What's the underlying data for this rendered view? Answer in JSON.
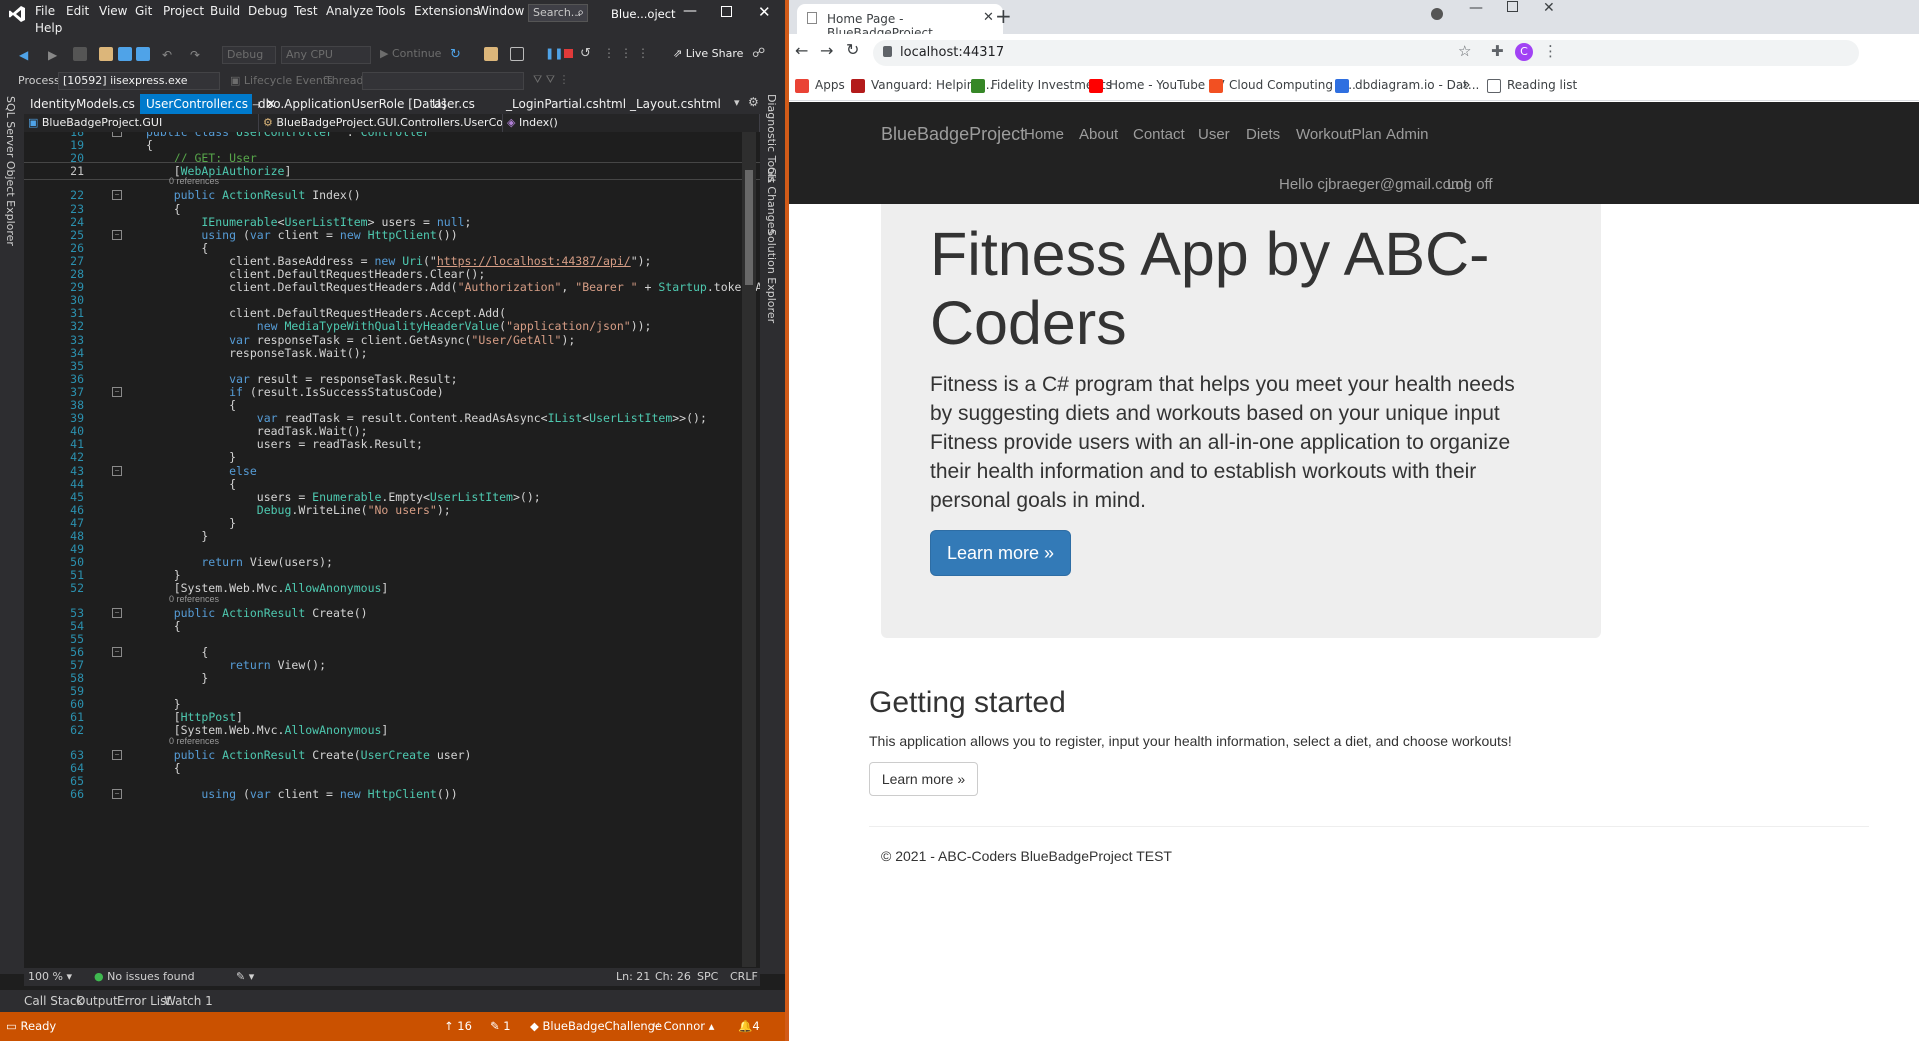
{
  "vs": {
    "menu": [
      "File",
      "Edit",
      "View",
      "Git",
      "Project",
      "Build",
      "Debug",
      "Test",
      "Analyze",
      "Tools",
      "Extensions",
      "Window",
      "Help"
    ],
    "search_placeholder": "Search...",
    "solution_title": "Blue...oject",
    "toolbar": {
      "config": "Debug",
      "platform": "Any CPU",
      "continue": "Continue",
      "live_share": "Live Share"
    },
    "toolbar2": {
      "process_label": "Process:",
      "process_value": "[10592] iisexpress.exe",
      "lifecycle": "Lifecycle Events",
      "thread_label": "Thread:"
    },
    "left_strip": "SQL Server Object Explorer",
    "right_strip": [
      "Diagnostic Tools",
      "Git Changes",
      "Solution Explorer"
    ],
    "tabs": [
      "IdentityModels.cs",
      "UserController.cs",
      "dbo.ApplicationUserRole [Data]",
      "User.cs",
      "_LoginPartial.cshtml",
      "_Layout.cshtml"
    ],
    "nav": {
      "project": "BlueBadgeProject.GUI",
      "class": "BlueBadgeProject.GUI.Controllers.UserController",
      "method": "Index()"
    },
    "code_lines": [
      {
        "n": "18",
        "segs": [
          [
            "kw",
            "public class "
          ],
          [
            "ty",
            "UserController"
          ],
          [
            "",
            "  : "
          ],
          [
            "ty",
            "Controller"
          ]
        ]
      },
      {
        "n": "19",
        "segs": [
          [
            "",
            "{"
          ]
        ]
      },
      {
        "n": "20",
        "segs": [
          [
            "cm",
            "    // GET: User"
          ]
        ]
      },
      {
        "n": "21",
        "segs": [
          [
            "",
            "    ["
          ],
          [
            "ty",
            "WebApiAuthorize"
          ],
          [
            "",
            "]"
          ]
        ]
      },
      {
        "n": "22",
        "segs": [
          [
            "kw",
            "    public "
          ],
          [
            "ty",
            "ActionResult"
          ],
          [
            "",
            " Index()"
          ]
        ]
      },
      {
        "n": "23",
        "segs": [
          [
            "",
            "    {"
          ]
        ]
      },
      {
        "n": "24",
        "segs": [
          [
            "ty",
            "        IEnumerable"
          ],
          [
            "",
            "<"
          ],
          [
            "ty",
            "UserListItem"
          ],
          [
            "",
            "> users = "
          ],
          [
            "kw",
            "null"
          ],
          [
            "",
            ";"
          ]
        ]
      },
      {
        "n": "25",
        "segs": [
          [
            "kw",
            "        using "
          ],
          [
            "",
            "("
          ],
          [
            "kw",
            "var"
          ],
          [
            "",
            " client = "
          ],
          [
            "kw",
            "new "
          ],
          [
            "ty",
            "HttpClient"
          ],
          [
            "",
            "())"
          ]
        ]
      },
      {
        "n": "26",
        "segs": [
          [
            "",
            "        {"
          ]
        ]
      },
      {
        "n": "27",
        "segs": [
          [
            "",
            "            client.BaseAddress = "
          ],
          [
            "kw",
            "new "
          ],
          [
            "ty",
            "Uri"
          ],
          [
            "",
            "(\""
          ],
          [
            "url",
            "https://localhost:44387/api/"
          ],
          [
            "",
            "\");"
          ]
        ]
      },
      {
        "n": "28",
        "segs": [
          [
            "",
            "            client.DefaultRequestHeaders.Clear();"
          ]
        ]
      },
      {
        "n": "29",
        "segs": [
          [
            "",
            "            client.DefaultRequestHeaders.Add("
          ],
          [
            "str",
            "\"Authorization\""
          ],
          [
            "",
            ", "
          ],
          [
            "str",
            "\"Bearer \""
          ],
          [
            "",
            " + "
          ],
          [
            "ty",
            "Startup"
          ],
          [
            "",
            ".token.AccessToken);"
          ]
        ]
      },
      {
        "n": "30",
        "segs": [
          [
            "",
            ""
          ]
        ]
      },
      {
        "n": "31",
        "segs": [
          [
            "",
            "            client.DefaultRequestHeaders.Accept.Add("
          ]
        ]
      },
      {
        "n": "32",
        "segs": [
          [
            "kw",
            "                new "
          ],
          [
            "ty",
            "MediaTypeWithQualityHeaderValue"
          ],
          [
            "",
            "("
          ],
          [
            "str",
            "\"application/json\""
          ],
          [
            "",
            "));"
          ]
        ]
      },
      {
        "n": "33",
        "segs": [
          [
            "kw",
            "            var"
          ],
          [
            "",
            " responseTask = client.GetAsync("
          ],
          [
            "str",
            "\"User/GetAll\""
          ],
          [
            "",
            ");"
          ]
        ]
      },
      {
        "n": "34",
        "segs": [
          [
            "",
            "            responseTask.Wait();"
          ]
        ]
      },
      {
        "n": "35",
        "segs": [
          [
            "",
            ""
          ]
        ]
      },
      {
        "n": "36",
        "segs": [
          [
            "kw",
            "            var"
          ],
          [
            "",
            " result = responseTask.Result;"
          ]
        ]
      },
      {
        "n": "37",
        "segs": [
          [
            "kw",
            "            if"
          ],
          [
            "",
            " (result.IsSuccessStatusCode)"
          ]
        ]
      },
      {
        "n": "38",
        "segs": [
          [
            "",
            "            {"
          ]
        ]
      },
      {
        "n": "39",
        "segs": [
          [
            "kw",
            "                var"
          ],
          [
            "",
            " readTask = result.Content.ReadAsAsync<"
          ],
          [
            "ty",
            "IList"
          ],
          [
            "",
            "<"
          ],
          [
            "ty",
            "UserListItem"
          ],
          [
            "",
            ">>();"
          ]
        ]
      },
      {
        "n": "40",
        "segs": [
          [
            "",
            "                readTask.Wait();"
          ]
        ]
      },
      {
        "n": "41",
        "segs": [
          [
            "",
            "                users = readTask.Result;"
          ]
        ]
      },
      {
        "n": "42",
        "segs": [
          [
            "",
            "            }"
          ]
        ]
      },
      {
        "n": "43",
        "segs": [
          [
            "kw",
            "            else"
          ]
        ]
      },
      {
        "n": "44",
        "segs": [
          [
            "",
            "            {"
          ]
        ]
      },
      {
        "n": "45",
        "segs": [
          [
            "",
            "                users = "
          ],
          [
            "ty",
            "Enumerable"
          ],
          [
            "",
            ".Empty<"
          ],
          [
            "ty",
            "UserListItem"
          ],
          [
            "",
            ">();"
          ]
        ]
      },
      {
        "n": "46",
        "segs": [
          [
            "ty",
            "                Debug"
          ],
          [
            "",
            ".WriteLine("
          ],
          [
            "str",
            "\"No users\""
          ],
          [
            "",
            ");"
          ]
        ]
      },
      {
        "n": "47",
        "segs": [
          [
            "",
            "            }"
          ]
        ]
      },
      {
        "n": "48",
        "segs": [
          [
            "",
            "        }"
          ]
        ]
      },
      {
        "n": "49",
        "segs": [
          [
            "",
            ""
          ]
        ]
      },
      {
        "n": "50",
        "segs": [
          [
            "kw",
            "        return "
          ],
          [
            "",
            "View(users);"
          ]
        ]
      },
      {
        "n": "51",
        "segs": [
          [
            "",
            "    }"
          ]
        ]
      },
      {
        "n": "52",
        "segs": [
          [
            "",
            "    [System.Web.Mvc."
          ],
          [
            "ty",
            "AllowAnonymous"
          ],
          [
            "",
            "]"
          ]
        ]
      },
      {
        "n": "53",
        "segs": [
          [
            "kw",
            "    public "
          ],
          [
            "ty",
            "ActionResult"
          ],
          [
            "",
            " Create()"
          ]
        ]
      },
      {
        "n": "54",
        "segs": [
          [
            "",
            "    {"
          ]
        ]
      },
      {
        "n": "55",
        "segs": [
          [
            "",
            ""
          ]
        ]
      },
      {
        "n": "56",
        "segs": [
          [
            "",
            "        {"
          ]
        ]
      },
      {
        "n": "57",
        "segs": [
          [
            "kw",
            "            return "
          ],
          [
            "",
            "View();"
          ]
        ]
      },
      {
        "n": "58",
        "segs": [
          [
            "",
            "        }"
          ]
        ]
      },
      {
        "n": "59",
        "segs": [
          [
            "",
            ""
          ]
        ]
      },
      {
        "n": "60",
        "segs": [
          [
            "",
            "    }"
          ]
        ]
      },
      {
        "n": "61",
        "segs": [
          [
            "",
            "    ["
          ],
          [
            "ty",
            "HttpPost"
          ],
          [
            "",
            "]"
          ]
        ]
      },
      {
        "n": "62",
        "segs": [
          [
            "",
            "    [System.Web.Mvc."
          ],
          [
            "ty",
            "AllowAnonymous"
          ],
          [
            "",
            "]"
          ]
        ]
      },
      {
        "n": "63",
        "segs": [
          [
            "kw",
            "    public "
          ],
          [
            "ty",
            "ActionResult"
          ],
          [
            "",
            " Create("
          ],
          [
            "ty",
            "UserCreate"
          ],
          [
            "",
            " user)"
          ]
        ]
      },
      {
        "n": "64",
        "segs": [
          [
            "",
            "    {"
          ]
        ]
      },
      {
        "n": "65",
        "segs": [
          [
            "",
            ""
          ]
        ]
      },
      {
        "n": "66",
        "segs": [
          [
            "kw",
            "        using "
          ],
          [
            "",
            "("
          ],
          [
            "kw",
            "var"
          ],
          [
            "",
            " client = "
          ],
          [
            "kw",
            "new "
          ],
          [
            "ty",
            "HttpClient"
          ],
          [
            "",
            "())"
          ]
        ]
      }
    ],
    "references_text": "0 references",
    "status": {
      "zoom": "100 %",
      "issues": "No issues found",
      "ln": "Ln: 21",
      "ch": "Ch: 26",
      "spc": "SPC",
      "crlf": "CRLF"
    },
    "bottom_tabs": [
      "Call Stack",
      "Output",
      "Error List",
      "Watch 1"
    ],
    "statusbar": {
      "ready": "Ready",
      "up": "16",
      "pencil": "1",
      "repo": "BlueBadgeChallenge",
      "branch": "Connor",
      "notif": "4"
    }
  },
  "browser": {
    "tab_title": "Home Page - BlueBadgeProject",
    "url": "localhost:44317",
    "profile_initial": "C",
    "bookmarks": [
      "Apps",
      "Vanguard: Helping...",
      "Fidelity Investments",
      "Home - YouTube TV",
      "Cloud Computing S...",
      "dbdiagram.io - Dat..."
    ],
    "bookmark_more": "»",
    "reading_list": "Reading list",
    "site": {
      "brand": "BlueBadgeProject",
      "nav": [
        "Home",
        "About",
        "Contact",
        "User",
        "Diets",
        "WorkoutPlan",
        "Admin"
      ],
      "hello": "Hello cjbraeger@gmail.com!",
      "logoff": "Log off",
      "jumbo_title": "Fitness App by ABC-Coders",
      "jumbo_lead": "Fitness is a C# program that helps you meet your health needs by suggesting diets and workouts based on your unique input Fitness provide users with an all-in-one application to organize their health information and to establish workouts with their personal goals in mind.",
      "jumbo_button": "Learn more »",
      "gs_title": "Getting started",
      "gs_text": "This application allows you to register, input your health information, select a diet, and choose workouts!",
      "gs_button": "Learn more »",
      "footer": "© 2021 - ABC-Coders BlueBadgeProject TEST"
    }
  }
}
